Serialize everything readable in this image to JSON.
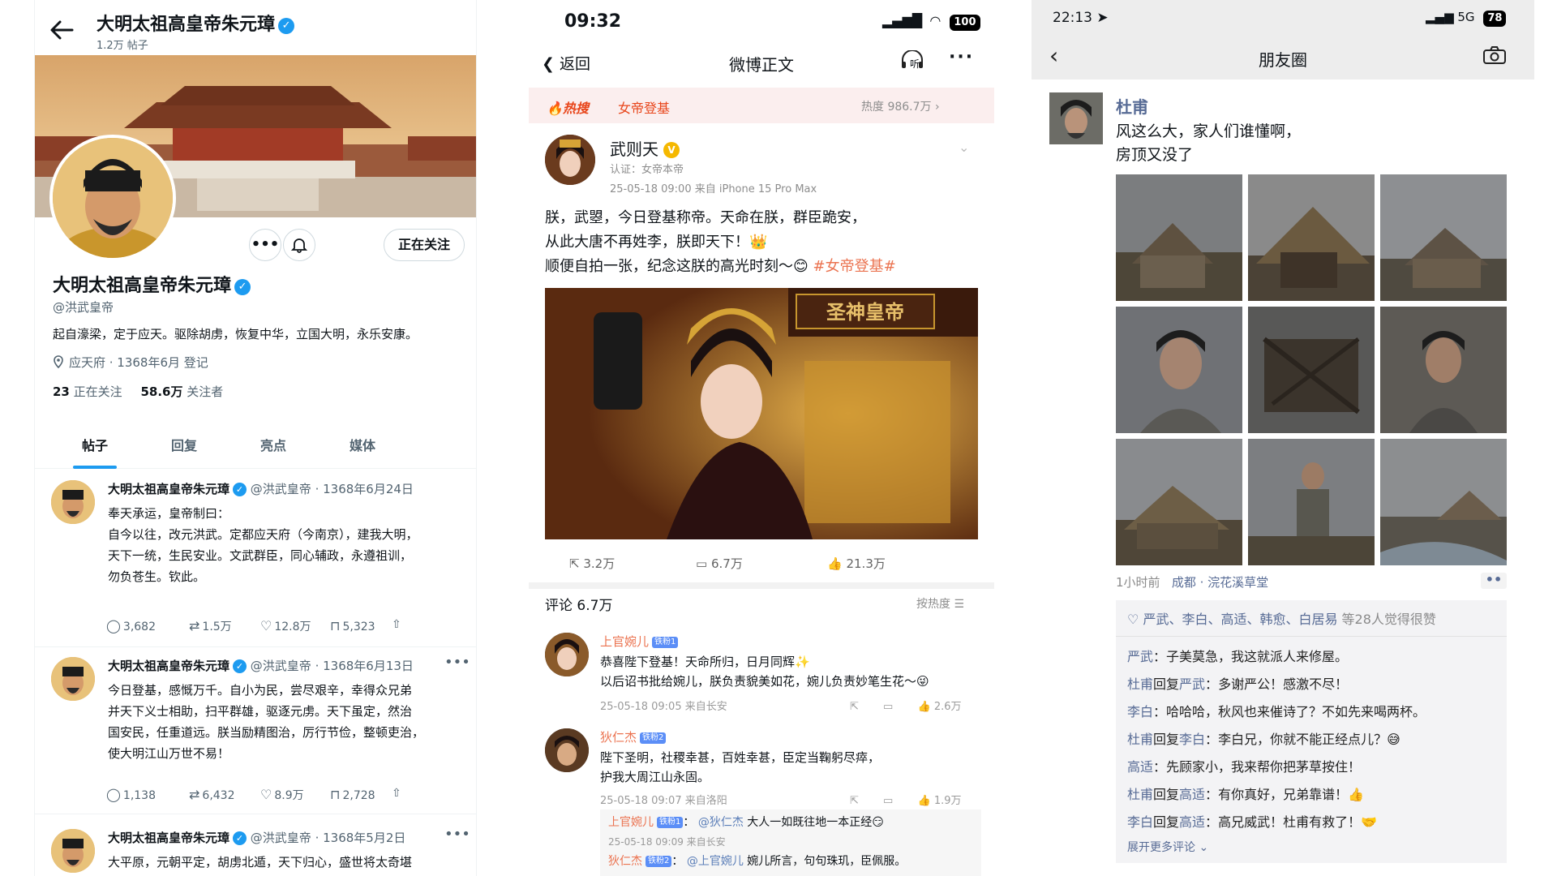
{
  "x_profile": {
    "top_name": "大明太祖高皇帝朱元璋",
    "post_count": "1.2万 帖子",
    "more_button": "•••",
    "following_button": "正在关注",
    "name": "大明太祖高皇帝朱元璋",
    "handle": "@洪武皇帝",
    "bio": "起自濠梁，定于应天。驱除胡虏，恢复中华，立国大明，永乐安康。",
    "location": "应天府 · 1368年6月 登记",
    "following_count": "23",
    "following_label": "正在关注",
    "followers_count": "58.6万",
    "followers_label": "关注者",
    "tabs": [
      "帖子",
      "回复",
      "亮点",
      "媒体"
    ],
    "tweets": [
      {
        "name": "大明太祖高皇帝朱元璋",
        "meta": "@洪武皇帝 · 1368年6月24日",
        "lines": [
          "奉天承运，皇帝制曰：",
          "自今以往，改元洪武。定都应天府（今南京），建我大明，",
          "天下一统，生民安业。文武群臣，同心辅政，永遵祖训，",
          "勿负苍生。钦此。"
        ],
        "replies": "3,682",
        "retweets": "1.5万",
        "likes": "12.8万",
        "bookmarks": "5,323"
      },
      {
        "name": "大明太祖高皇帝朱元璋",
        "meta": "@洪武皇帝 · 1368年6月13日",
        "lines": [
          "今日登基，感慨万千。自小为民，尝尽艰辛，幸得众兄弟",
          "并天下义士相助，扫平群雄，驱逐元虏。天下虽定，然治",
          "国安民，任重道远。朕当励精图治，厉行节俭，整顿吏治，",
          "使大明江山万世不易！"
        ],
        "replies": "1,138",
        "retweets": "6,432",
        "likes": "8.9万",
        "bookmarks": "2,728"
      },
      {
        "name": "大明太祖高皇帝朱元璋",
        "meta": "@洪武皇帝 · 1368年5月2日",
        "lines": [
          "大平原，元朝平定，胡虏北遁，天下归心，盛世将太奇堪"
        ]
      }
    ]
  },
  "weibo": {
    "status_time": "09:32",
    "battery": "100",
    "back_label": "返回",
    "title": "微博正文",
    "listen_label": "听",
    "hot_label": "热搜",
    "hot_topic": "女帝登基",
    "hot_heat": "热度 986.7万",
    "author": "武则天",
    "auth": "认证：女帝本帝",
    "post_meta": "25-05-18 09:00  来自 iPhone 15 Pro Max",
    "text_lines": [
      "朕，武曌，今日登基称帝。天命在朕，群臣跪安，",
      "从此大唐不再姓李，朕即天下！👑"
    ],
    "text_line3": "顺便自拍一张，纪念这朕的高光时刻～😊 ",
    "hashtag": "#女帝登基#",
    "plaque_text": "圣神皇帝",
    "reposts": "3.2万",
    "comments": "6.7万",
    "likes": "21.3万",
    "comment_header": "评论 6.7万",
    "sort_label": "按热度",
    "comment_list": [
      {
        "name": "上官婉儿",
        "badge": "铁粉1",
        "lines": [
          "恭喜陛下登基！天命所归，日月同辉✨",
          "以后诏书批给婉儿，朕负责貌美如花，婉儿负责妙笔生花～😜"
        ],
        "meta": "25-05-18 09:05  来自长安",
        "likes": "2.6万"
      },
      {
        "name": "狄仁杰",
        "badge": "铁粉2",
        "lines": [
          "陛下圣明，社稷幸甚，百姓幸甚，臣定当鞠躬尽瘁，",
          "护我大周江山永固。"
        ],
        "meta": "25-05-18 09:07  来自洛阳",
        "likes": "1.9万"
      }
    ],
    "replies": [
      {
        "name": "上官婉儿",
        "badge": "铁粉1",
        "at": "@狄仁杰",
        "text": "大人一如既往地一本正经😏",
        "meta": "25-05-18 09:09  来自长安"
      },
      {
        "name": "狄仁杰",
        "badge": "铁粉2",
        "at": "@上官婉儿",
        "text": "婉儿所言，句句珠玑，臣佩服。"
      }
    ]
  },
  "wechat": {
    "status_time": "22:13",
    "network": "5G",
    "battery": "78",
    "title": "朋友圈",
    "poster": "杜甫",
    "text_lines": [
      "风这么大，家人们谁懂啊，",
      "房顶又没了"
    ],
    "time_ago": "1小时前",
    "location": "成都 · 浣花溪草堂",
    "likes_names": "严武、李白、高适、韩愈、白居易",
    "likes_count": "等28人觉得很赞",
    "comments": [
      {
        "from": "严武",
        "to": "",
        "text": "子美莫急，我这就派人来修屋。"
      },
      {
        "from": "杜甫",
        "to": "严武",
        "text": "多谢严公！感激不尽！"
      },
      {
        "from": "李白",
        "to": "",
        "text": "哈哈哈，秋风也来催诗了？不如先来喝两杯。"
      },
      {
        "from": "杜甫",
        "to": "李白",
        "text": "李白兄，你就不能正经点儿？😅"
      },
      {
        "from": "高适",
        "to": "",
        "text": "先顾家小，我来帮你把茅草按住！"
      },
      {
        "from": "杜甫",
        "to": "高适",
        "text": "有你真好，兄弟靠谱！👍"
      },
      {
        "from": "李白",
        "to": "高适",
        "text": "高兄威武！杜甫有救了！🤝"
      }
    ],
    "reply_word": "回复",
    "colon": "：",
    "more_comments": "展开更多评论 ⌄"
  }
}
